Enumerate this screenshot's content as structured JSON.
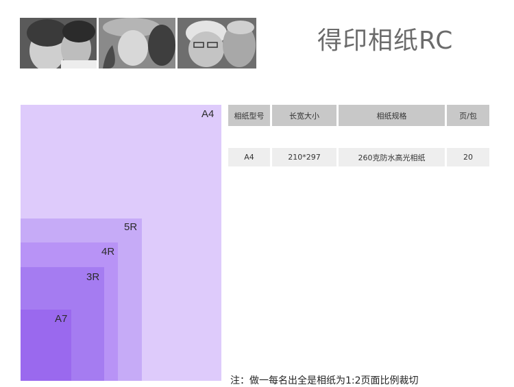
{
  "title": "得印相纸RC",
  "photos": [
    {
      "icon": "children-kiss-photo"
    },
    {
      "icon": "couple-smiling-photo"
    },
    {
      "icon": "elderly-couple-photo"
    }
  ],
  "sizes": [
    {
      "label": "A4",
      "color": "#decbfb"
    },
    {
      "label": "5R",
      "color": "#c6abf7"
    },
    {
      "label": "4R",
      "color": "#b893f6"
    },
    {
      "label": "3R",
      "color": "#a57cf1"
    },
    {
      "label": "A7",
      "color": "#9a69ee"
    }
  ],
  "table": {
    "headers": [
      "相纸型号",
      "长宽大小",
      "相纸规格",
      "页/包"
    ],
    "rows": [
      [
        "A4",
        "210*297",
        "260克防水高光相纸",
        "20"
      ]
    ]
  },
  "note": "注：做一每名出全是相纸为1:2页面比例裁切"
}
